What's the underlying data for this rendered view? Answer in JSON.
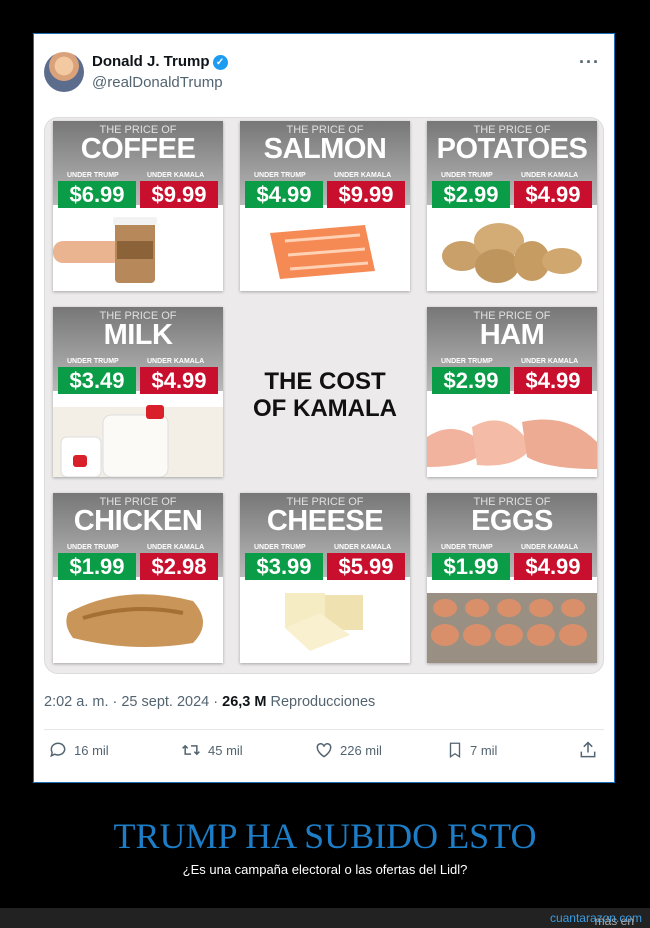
{
  "tweet": {
    "name": "Donald J. Trump",
    "handle": "@realDonaldTrump",
    "timestamp": "2:02 a. m. · 25 sept. 2024 · ",
    "views": "26,3 M",
    "views_label": "Reproducciones"
  },
  "image": {
    "price_of": "THE PRICE OF",
    "under_trump": "UNDER TRUMP",
    "under_kamala": "UNDER KAMALA",
    "center_line1": "THE COST",
    "center_line2": "OF KAMALA",
    "items": [
      {
        "name": "COFFEE",
        "trump": "$6.99",
        "kamala": "$9.99"
      },
      {
        "name": "SALMON",
        "trump": "$4.99",
        "kamala": "$9.99"
      },
      {
        "name": "POTATOES",
        "trump": "$2.99",
        "kamala": "$4.99"
      },
      {
        "name": "MILK",
        "trump": "$3.49",
        "kamala": "$4.99"
      },
      {
        "name": "HAM",
        "trump": "$2.99",
        "kamala": "$4.99"
      },
      {
        "name": "CHICKEN",
        "trump": "$1.99",
        "kamala": "$2.98"
      },
      {
        "name": "CHEESE",
        "trump": "$3.99",
        "kamala": "$5.99"
      },
      {
        "name": "EGGS",
        "trump": "$1.99",
        "kamala": "$4.99"
      }
    ]
  },
  "actions": {
    "replies": "16 mil",
    "retweets": "45 mil",
    "likes": "226 mil",
    "bookmarks": "7 mil"
  },
  "page": {
    "headline": "TRUMP HA SUBIDO ESTO",
    "subtitle": "¿Es una campaña electoral o las ofertas del Lidl?",
    "footer_prefix": "más en ",
    "footer_link": "cuantarazon.com"
  },
  "colors": {
    "trump_green": "#0a9c46",
    "kamala_red": "#c8102e",
    "headline_blue": "#1d7ec7"
  }
}
